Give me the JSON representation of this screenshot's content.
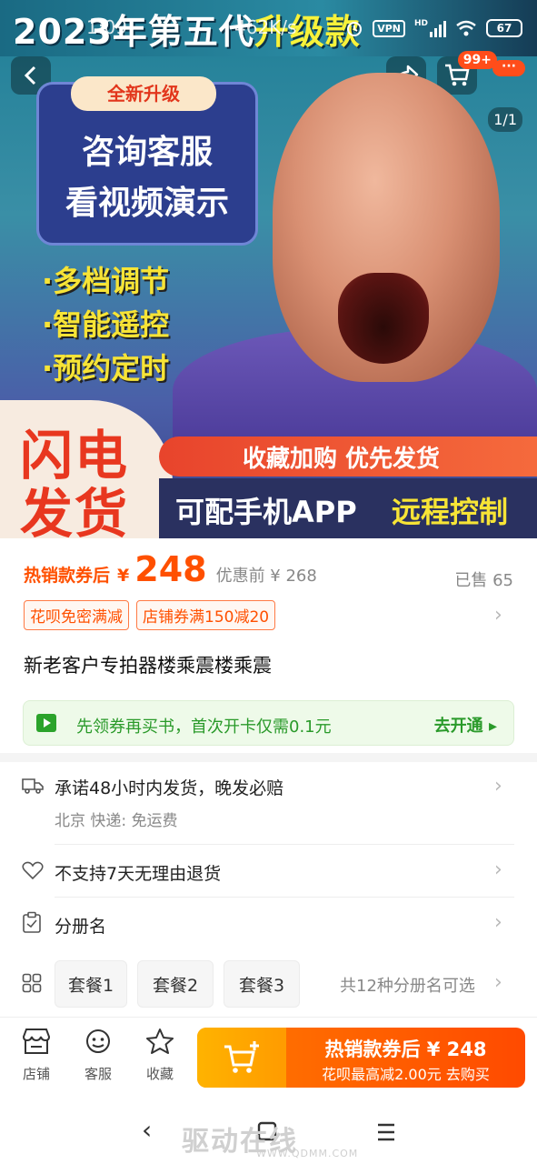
{
  "banner": {
    "title_main": "2023年第五代",
    "title_highlight": "升级款"
  },
  "status": {
    "time": "1:09",
    "speed": "462K/s",
    "vpn": "VPN",
    "network": "HD",
    "battery": "67"
  },
  "header": {
    "cart_badge": "99+",
    "more_badge": "···",
    "page_indicator": "1/1"
  },
  "hero": {
    "promo_tag": "全新升级",
    "promo_line1": "咨询客服",
    "promo_line2": "看视频演示",
    "features": [
      "·多档调节",
      "·智能遥控",
      "·预约定时"
    ],
    "flash_line1": "闪电",
    "flash_line2": "发货",
    "strip_text": "收藏加购 优先发货",
    "bottom_text": "可配手机APP",
    "bottom_highlight": "远程控制"
  },
  "price": {
    "label": "热销款券后",
    "currency": "¥",
    "value": "248",
    "before": "优惠前 ¥ 268",
    "sold": "已售 65"
  },
  "tags": [
    "花呗免密满减",
    "店铺券满150减20"
  ],
  "product_title": "新老客户专拍器楼乘震楼乘震",
  "vip": {
    "text": "先领券再买书，首次开卡仅需0.1元",
    "action": "去开通 ▸"
  },
  "shipping": {
    "promise": "承诺48小时内发货，晚发必赔",
    "detail": "北京  快递: 免运费"
  },
  "return_policy": "不支持7天无理由退货",
  "variant_label": "分册名",
  "packages": [
    "套餐1",
    "套餐2",
    "套餐3"
  ],
  "package_note": "共12种分册名可选",
  "actions": {
    "store": "店铺",
    "service": "客服",
    "favorite": "收藏"
  },
  "buy": {
    "line1": "热销款券后 ¥ 248",
    "line2": "花呗最高减2.00元  去购买"
  },
  "watermark": {
    "text": "驱动在线",
    "url": "WWW.QDMM.COM"
  },
  "colors": {
    "accent": "#ff5000",
    "green": "#2a9a2a",
    "buy_start": "#ffb300",
    "buy_end": "#ff4a00"
  }
}
